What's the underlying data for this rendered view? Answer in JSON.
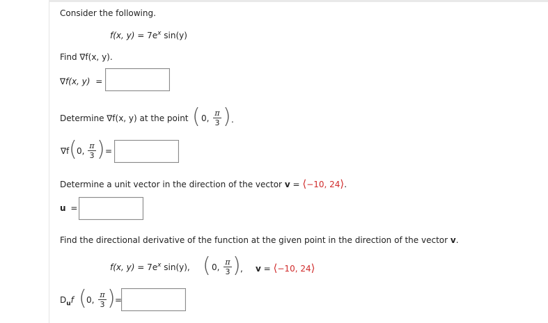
{
  "problem": {
    "intro": "Consider the following.",
    "function_lhs": "f(x, y)",
    "function_eq": " = 7e",
    "function_sup": "x",
    "function_rhs": " sin(y)",
    "q1": "Find ∇f(x, y).",
    "q1_label_nabla": "∇",
    "q1_label_rest": "f(x, y)",
    "equals": "=",
    "q2_prefix": "Determine ∇f(x, y) at the point",
    "point_zero": "0,",
    "pi": "π",
    "three": "3",
    "dot": ".",
    "q2_label": "∇f",
    "q3_prefix": "Determine a unit vector in the direction of the vector",
    "v_bold": "v",
    "v_eq": " = ",
    "v_open": "⟨",
    "v_values": "−10, 24",
    "v_close": "⟩",
    "period": ".",
    "u_label": "u",
    "q4": "Find the directional derivative of the function at the given point in the direction of the vector",
    "q4_v": "v",
    "q4_period": ".",
    "summary_func": "f(x, y) = 7e",
    "summary_sup": "x",
    "summary_rest": " sin(y),",
    "comma": ",",
    "summary_v": "v",
    "summary_v_eq": " = ",
    "summary_v_vals": "−10, 24",
    "du_d": "D",
    "du_u": "u",
    "du_f": "f"
  },
  "answers": {
    "gradient": "",
    "gradient_at_point": "",
    "unit_vector": "",
    "directional_derivative": ""
  }
}
